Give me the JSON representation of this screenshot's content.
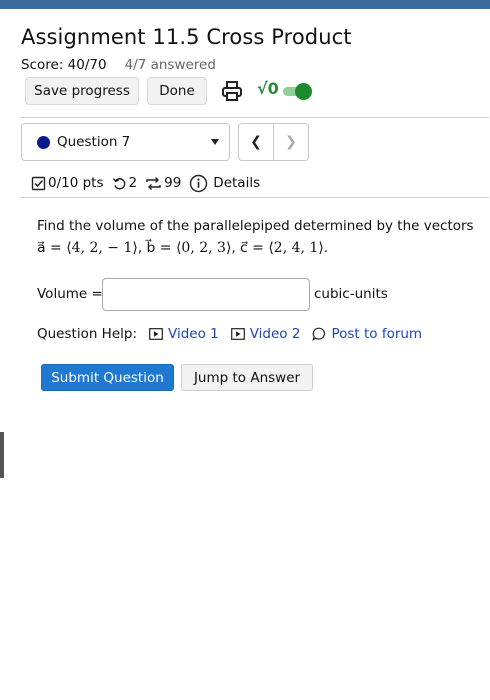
{
  "assignment": {
    "title": "Assignment 11.5 Cross Product",
    "score": "Score: 40/70",
    "answered": "4/7 answered"
  },
  "toolbar": {
    "save_label": "Save progress",
    "done_label": "Done",
    "print_icon": "printer-icon",
    "math_toggle_icon": "√0",
    "math_toggle_on": true
  },
  "question_nav": {
    "selected": "Question 7",
    "prev_icon": "chevron-left-icon",
    "next_icon": "chevron-right-icon"
  },
  "question_meta": {
    "points": "0/10 pts",
    "retries": "2",
    "attempts": "99",
    "details_label": "Details"
  },
  "question": {
    "prompt": "Find the volume of the parallelepiped determined by the vectors",
    "vector_a": "a⃗ = ⟨4, 2, − 1⟩",
    "vector_b": "b⃗ = ⟨0, 2, 3⟩",
    "vector_c": "c⃗ = ⟨2, 4, 1⟩"
  },
  "answer": {
    "label": "Volume =",
    "value": "",
    "unit": "cubic-units"
  },
  "help": {
    "label": "Question Help:",
    "video1": "Video 1",
    "video2": "Video 2",
    "forum": "Post to forum"
  },
  "actions": {
    "submit_label": "Submit Question",
    "jump_label": "Jump to Answer"
  },
  "colors": {
    "header_bar": "#3e6aa0",
    "primary_button": "#1f79d1",
    "link": "#2046b3",
    "toggle_on": "#1b8a2e",
    "question_dot": "#0a1a8c"
  }
}
